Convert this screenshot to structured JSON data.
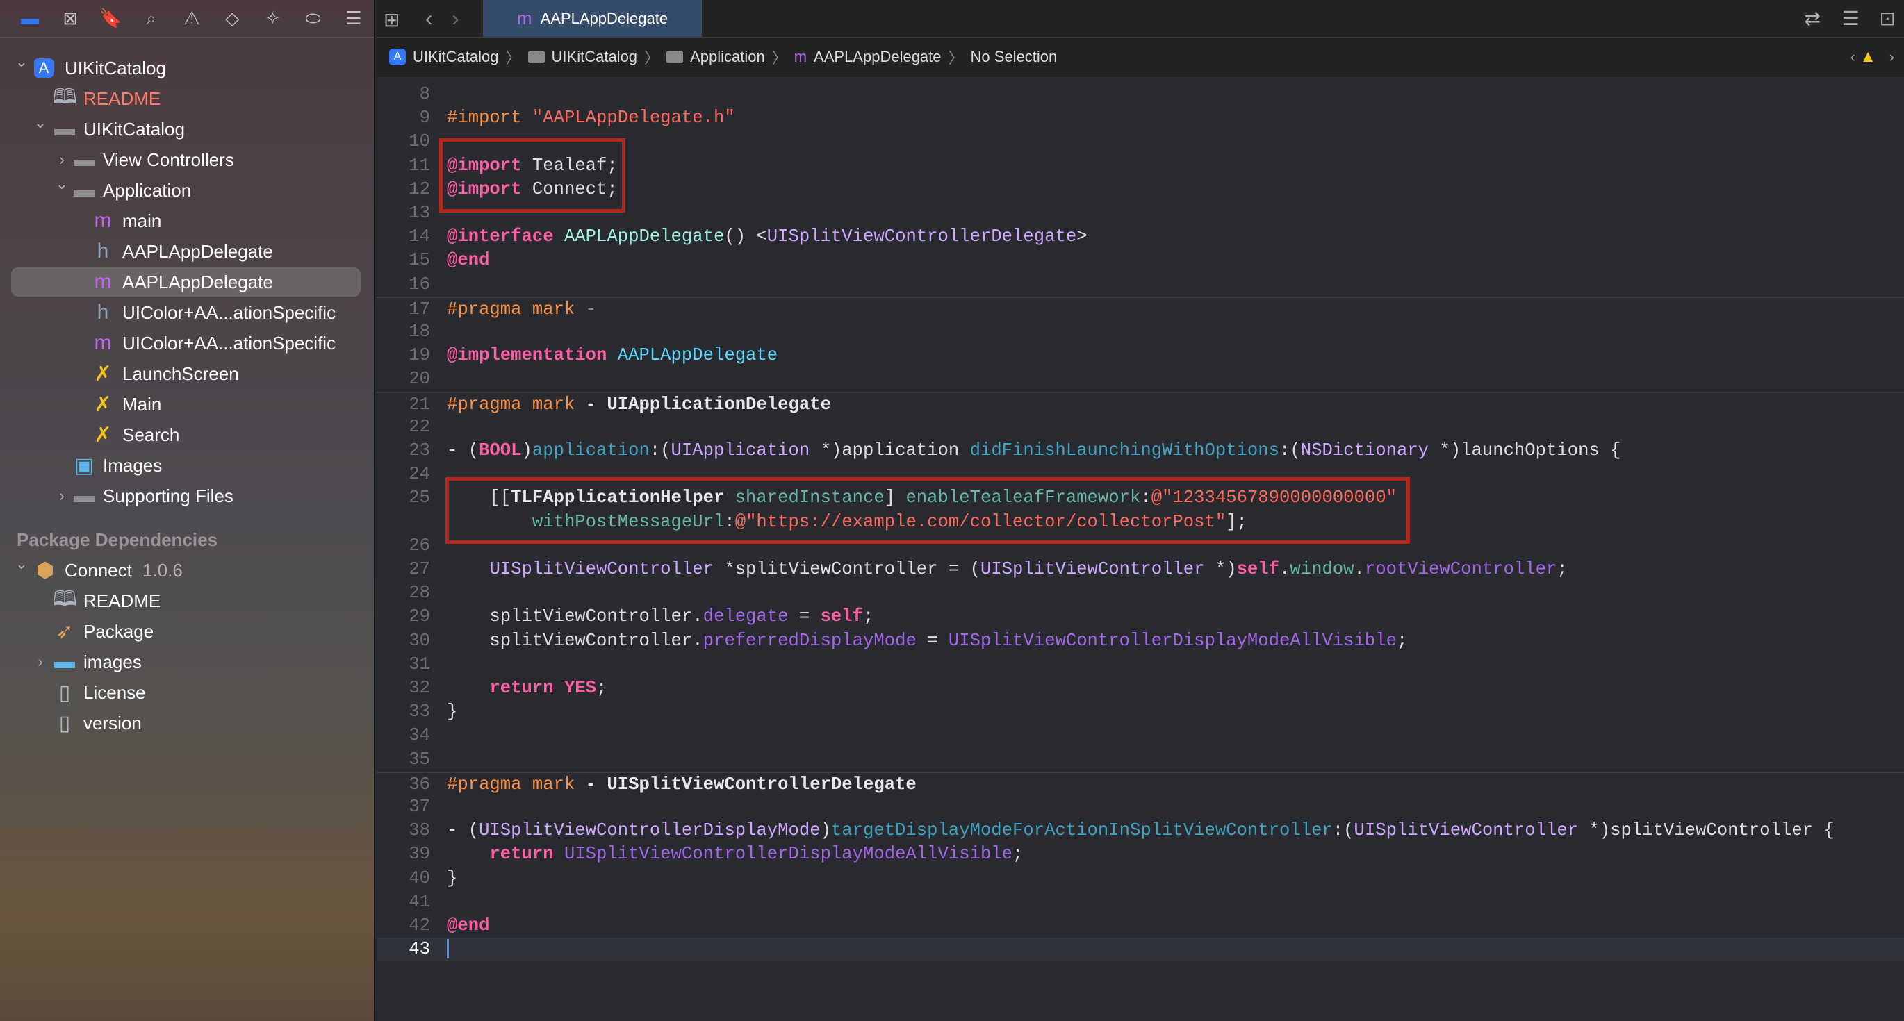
{
  "navigator": {
    "icons": [
      "folder-icon",
      "source-control-icon",
      "bookmark-icon",
      "search-icon",
      "warning-icon",
      "test-icon",
      "debug-icon",
      "breakpoint-icon",
      "report-icon"
    ],
    "tree": [
      {
        "label": "UIKitCatalog",
        "level": 0,
        "chevron": "down",
        "icon": "app-project-icon"
      },
      {
        "label": "README",
        "level": 1,
        "icon": "book-icon",
        "color": "#ff7b6e"
      },
      {
        "label": "UIKitCatalog",
        "level": 1,
        "chevron": "down",
        "icon": "folder-icon"
      },
      {
        "label": "View Controllers",
        "level": 2,
        "chevron": "right",
        "icon": "folder-icon"
      },
      {
        "label": "Application",
        "level": 2,
        "chevron": "down",
        "icon": "folder-icon"
      },
      {
        "label": "main",
        "level": 3,
        "icon": "m-file-icon"
      },
      {
        "label": "AAPLAppDelegate",
        "level": 3,
        "icon": "h-file-icon"
      },
      {
        "label": "AAPLAppDelegate",
        "level": 3,
        "icon": "m-file-icon",
        "selected": true
      },
      {
        "label": "UIColor+AA...ationSpecific",
        "level": 3,
        "icon": "h-file-icon"
      },
      {
        "label": "UIColor+AA...ationSpecific",
        "level": 3,
        "icon": "m-file-icon"
      },
      {
        "label": "LaunchScreen",
        "level": 3,
        "icon": "storyboard-icon"
      },
      {
        "label": "Main",
        "level": 3,
        "icon": "storyboard-icon"
      },
      {
        "label": "Search",
        "level": 3,
        "icon": "storyboard-icon"
      },
      {
        "label": "Images",
        "level": 2,
        "icon": "asset-catalog-icon"
      },
      {
        "label": "Supporting Files",
        "level": 2,
        "chevron": "right",
        "icon": "folder-icon"
      }
    ],
    "section_header": "Package Dependencies",
    "packages": [
      {
        "label": "Connect",
        "version": "1.0.6",
        "level": 0,
        "chevron": "down",
        "icon": "package-icon"
      },
      {
        "label": "README",
        "level": 1,
        "icon": "book-icon"
      },
      {
        "label": "Package",
        "level": 1,
        "icon": "swift-icon"
      },
      {
        "label": "images",
        "level": 1,
        "chevron": "right",
        "icon": "folder-gear-icon"
      },
      {
        "label": "License",
        "level": 1,
        "icon": "document-icon"
      },
      {
        "label": "version",
        "level": 1,
        "icon": "document-icon"
      }
    ]
  },
  "tab": {
    "icon": "m",
    "title": "AAPLAppDelegate"
  },
  "breadcrumb": [
    "UIKitCatalog",
    "UIKitCatalog",
    "Application",
    "AAPLAppDelegate",
    "No Selection"
  ],
  "breadcrumb_m": "m",
  "code": [
    {
      "n": "8",
      "t": []
    },
    {
      "n": "9",
      "t": [
        [
          "pp",
          "#import"
        ],
        [
          "pl",
          " "
        ],
        [
          "str",
          "\"AAPLAppDelegate.h\""
        ]
      ]
    },
    {
      "n": "10",
      "t": []
    },
    {
      "n": "11",
      "t": [
        [
          "kw",
          "@import"
        ],
        [
          "pl",
          " Tealeaf;"
        ]
      ]
    },
    {
      "n": "12",
      "t": [
        [
          "kw",
          "@import"
        ],
        [
          "pl",
          " Connect;"
        ]
      ]
    },
    {
      "n": "13",
      "t": []
    },
    {
      "n": "14",
      "t": [
        [
          "kw",
          "@interface"
        ],
        [
          "pl",
          " "
        ],
        [
          "tealt",
          "AAPLAppDelegate"
        ],
        [
          "pl",
          "() <"
        ],
        [
          "lav",
          "UISplitViewControllerDelegate"
        ],
        [
          "pl",
          ">"
        ]
      ]
    },
    {
      "n": "15",
      "t": [
        [
          "kw",
          "@end"
        ]
      ]
    },
    {
      "n": "16",
      "t": []
    },
    {
      "n": "17",
      "sep": true,
      "t": [
        [
          "pp",
          "#pragma mark"
        ],
        [
          "dim",
          " -"
        ]
      ]
    },
    {
      "n": "18",
      "t": []
    },
    {
      "n": "19",
      "t": [
        [
          "kw",
          "@implementation"
        ],
        [
          "pl",
          " "
        ],
        [
          "decl",
          "AAPLAppDelegate"
        ]
      ]
    },
    {
      "n": "20",
      "t": []
    },
    {
      "n": "21",
      "sep": true,
      "t": [
        [
          "pp",
          "#pragma mark"
        ],
        [
          "plb",
          " - UIApplicationDelegate"
        ]
      ]
    },
    {
      "n": "22",
      "t": []
    },
    {
      "n": "23",
      "t": [
        [
          "pl",
          "- ("
        ],
        [
          "kw",
          "BOOL"
        ],
        [
          "pl",
          ")"
        ],
        [
          "fn",
          "application"
        ],
        [
          "pl",
          ":("
        ],
        [
          "lav",
          "UIApplication"
        ],
        [
          "pl",
          " *)application "
        ],
        [
          "fn",
          "didFinishLaunchingWithOptions"
        ],
        [
          "pl",
          ":("
        ],
        [
          "lav",
          "NSDictionary"
        ],
        [
          "pl",
          " *)launchOptions {"
        ]
      ]
    },
    {
      "n": "24",
      "t": []
    },
    {
      "n": "25",
      "t": [
        [
          "pl",
          "    [["
        ],
        [
          "plb",
          "TLFApplicationHelper"
        ],
        [
          "pl",
          " "
        ],
        [
          "grn",
          "sharedInstance"
        ],
        [
          "pl",
          "] "
        ],
        [
          "grn",
          "enableTealeafFramework"
        ],
        [
          "pl",
          ":"
        ],
        [
          "str",
          "@\"12334567890000000000\""
        ]
      ]
    },
    {
      "n": "",
      "t": [
        [
          "pl",
          "        "
        ],
        [
          "grn",
          "withPostMessageUrl"
        ],
        [
          "pl",
          ":"
        ],
        [
          "str",
          "@\"https://example.com/collector/collectorPost\""
        ],
        [
          "pl",
          "];"
        ]
      ]
    },
    {
      "n": "26",
      "t": []
    },
    {
      "n": "27",
      "t": [
        [
          "pl",
          "    "
        ],
        [
          "lav",
          "UISplitViewController"
        ],
        [
          "pl",
          " *splitViewController = ("
        ],
        [
          "lav",
          "UISplitViewController"
        ],
        [
          "pl",
          " *)"
        ],
        [
          "kw",
          "self"
        ],
        [
          "pl",
          "."
        ],
        [
          "grn",
          "window"
        ],
        [
          "pl",
          "."
        ],
        [
          "pur",
          "rootViewController"
        ],
        [
          "pl",
          ";"
        ]
      ]
    },
    {
      "n": "28",
      "t": []
    },
    {
      "n": "29",
      "t": [
        [
          "pl",
          "    splitViewController."
        ],
        [
          "pur",
          "delegate"
        ],
        [
          "pl",
          " = "
        ],
        [
          "kw",
          "self"
        ],
        [
          "pl",
          ";"
        ]
      ]
    },
    {
      "n": "30",
      "t": [
        [
          "pl",
          "    splitViewController."
        ],
        [
          "pur",
          "preferredDisplayMode"
        ],
        [
          "pl",
          " = "
        ],
        [
          "pur",
          "UISplitViewControllerDisplayModeAllVisible"
        ],
        [
          "pl",
          ";"
        ]
      ]
    },
    {
      "n": "31",
      "t": []
    },
    {
      "n": "32",
      "t": [
        [
          "pl",
          "    "
        ],
        [
          "kw",
          "return"
        ],
        [
          "pl",
          " "
        ],
        [
          "kw",
          "YES"
        ],
        [
          "pl",
          ";"
        ]
      ]
    },
    {
      "n": "33",
      "t": [
        [
          "pl",
          "}"
        ]
      ]
    },
    {
      "n": "34",
      "t": []
    },
    {
      "n": "35",
      "t": []
    },
    {
      "n": "36",
      "sep": true,
      "t": [
        [
          "pp",
          "#pragma mark"
        ],
        [
          "plb",
          " - UISplitViewControllerDelegate"
        ]
      ]
    },
    {
      "n": "37",
      "t": []
    },
    {
      "n": "38",
      "t": [
        [
          "pl",
          "- ("
        ],
        [
          "lav",
          "UISplitViewControllerDisplayMode"
        ],
        [
          "pl",
          ")"
        ],
        [
          "fn",
          "targetDisplayModeForActionInSplitViewController"
        ],
        [
          "pl",
          ":("
        ],
        [
          "lav",
          "UISplitViewController"
        ],
        [
          "pl",
          " *)splitViewController {"
        ]
      ]
    },
    {
      "n": "39",
      "t": [
        [
          "pl",
          "    "
        ],
        [
          "kw",
          "return"
        ],
        [
          "pl",
          " "
        ],
        [
          "pur",
          "UISplitViewControllerDisplayModeAllVisible"
        ],
        [
          "pl",
          ";"
        ]
      ]
    },
    {
      "n": "40",
      "t": [
        [
          "pl",
          "}"
        ]
      ]
    },
    {
      "n": "41",
      "t": []
    },
    {
      "n": "42",
      "t": [
        [
          "kw",
          "@end"
        ]
      ]
    },
    {
      "n": "43",
      "cur": true,
      "t": []
    }
  ],
  "colors": {
    "accent": "#3478f6",
    "highlight_box": "#b3271c",
    "warning": "#f5c518"
  }
}
